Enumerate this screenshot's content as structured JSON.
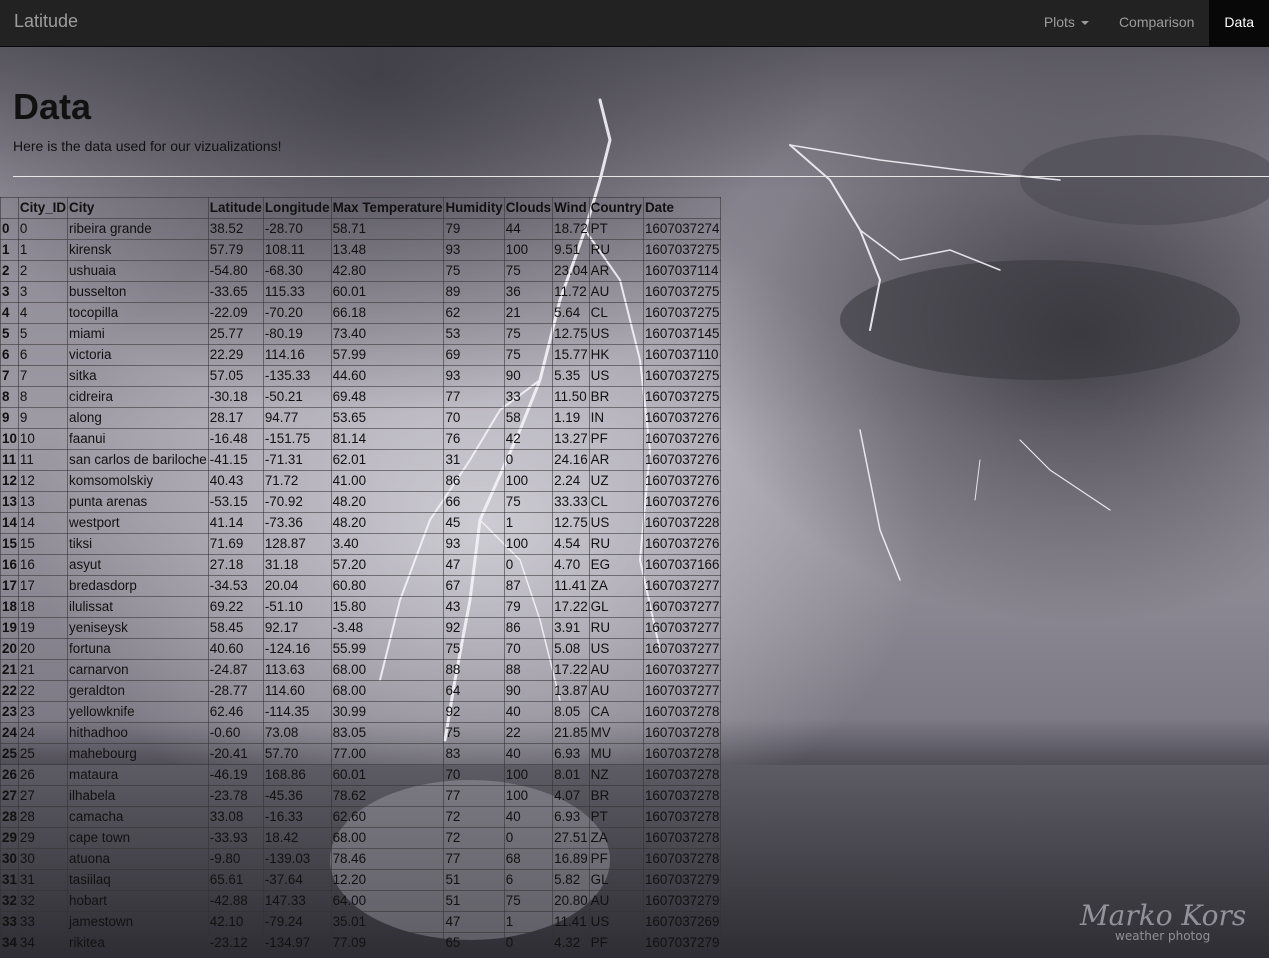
{
  "navbar": {
    "brand": "Latitude",
    "items": [
      {
        "label": "Plots",
        "dropdown": true,
        "active": false
      },
      {
        "label": "Comparison",
        "dropdown": false,
        "active": false
      },
      {
        "label": "Data",
        "dropdown": false,
        "active": true
      }
    ]
  },
  "page": {
    "title": "Data",
    "subtitle": "Here is the data used for our vizualizations!"
  },
  "background": {
    "description_icon": "lightning-storm-sea-photo",
    "watermark_line1": "Marko Kors",
    "watermark_line2": "weather photog"
  },
  "table": {
    "columns": [
      "",
      "City_ID",
      "City",
      "Latitude",
      "Longitude",
      "Max Temperature",
      "Humidity",
      "Clouds",
      "Wind",
      "Country",
      "Date"
    ],
    "rows": [
      [
        "0",
        "0",
        "ribeira grande",
        "38.52",
        "-28.70",
        "58.71",
        "79",
        "44",
        "18.72",
        "PT",
        "1607037274"
      ],
      [
        "1",
        "1",
        "kirensk",
        "57.79",
        "108.11",
        "13.48",
        "93",
        "100",
        "9.51",
        "RU",
        "1607037275"
      ],
      [
        "2",
        "2",
        "ushuaia",
        "-54.80",
        "-68.30",
        "42.80",
        "75",
        "75",
        "23.04",
        "AR",
        "1607037114"
      ],
      [
        "3",
        "3",
        "busselton",
        "-33.65",
        "115.33",
        "60.01",
        "89",
        "36",
        "11.72",
        "AU",
        "1607037275"
      ],
      [
        "4",
        "4",
        "tocopilla",
        "-22.09",
        "-70.20",
        "66.18",
        "62",
        "21",
        "5.64",
        "CL",
        "1607037275"
      ],
      [
        "5",
        "5",
        "miami",
        "25.77",
        "-80.19",
        "73.40",
        "53",
        "75",
        "12.75",
        "US",
        "1607037145"
      ],
      [
        "6",
        "6",
        "victoria",
        "22.29",
        "114.16",
        "57.99",
        "69",
        "75",
        "15.77",
        "HK",
        "1607037110"
      ],
      [
        "7",
        "7",
        "sitka",
        "57.05",
        "-135.33",
        "44.60",
        "93",
        "90",
        "5.35",
        "US",
        "1607037275"
      ],
      [
        "8",
        "8",
        "cidreira",
        "-30.18",
        "-50.21",
        "69.48",
        "77",
        "33",
        "11.50",
        "BR",
        "1607037275"
      ],
      [
        "9",
        "9",
        "along",
        "28.17",
        "94.77",
        "53.65",
        "70",
        "58",
        "1.19",
        "IN",
        "1607037276"
      ],
      [
        "10",
        "10",
        "faanui",
        "-16.48",
        "-151.75",
        "81.14",
        "76",
        "42",
        "13.27",
        "PF",
        "1607037276"
      ],
      [
        "11",
        "11",
        "san carlos de bariloche",
        "-41.15",
        "-71.31",
        "62.01",
        "31",
        "0",
        "24.16",
        "AR",
        "1607037276"
      ],
      [
        "12",
        "12",
        "komsomolskiy",
        "40.43",
        "71.72",
        "41.00",
        "86",
        "100",
        "2.24",
        "UZ",
        "1607037276"
      ],
      [
        "13",
        "13",
        "punta arenas",
        "-53.15",
        "-70.92",
        "48.20",
        "66",
        "75",
        "33.33",
        "CL",
        "1607037276"
      ],
      [
        "14",
        "14",
        "westport",
        "41.14",
        "-73.36",
        "48.20",
        "45",
        "1",
        "12.75",
        "US",
        "1607037228"
      ],
      [
        "15",
        "15",
        "tiksi",
        "71.69",
        "128.87",
        "3.40",
        "93",
        "100",
        "4.54",
        "RU",
        "1607037276"
      ],
      [
        "16",
        "16",
        "asyut",
        "27.18",
        "31.18",
        "57.20",
        "47",
        "0",
        "4.70",
        "EG",
        "1607037166"
      ],
      [
        "17",
        "17",
        "bredasdorp",
        "-34.53",
        "20.04",
        "60.80",
        "67",
        "87",
        "11.41",
        "ZA",
        "1607037277"
      ],
      [
        "18",
        "18",
        "ilulissat",
        "69.22",
        "-51.10",
        "15.80",
        "43",
        "79",
        "17.22",
        "GL",
        "1607037277"
      ],
      [
        "19",
        "19",
        "yeniseysk",
        "58.45",
        "92.17",
        "-3.48",
        "92",
        "86",
        "3.91",
        "RU",
        "1607037277"
      ],
      [
        "20",
        "20",
        "fortuna",
        "40.60",
        "-124.16",
        "55.99",
        "75",
        "70",
        "5.08",
        "US",
        "1607037277"
      ],
      [
        "21",
        "21",
        "carnarvon",
        "-24.87",
        "113.63",
        "68.00",
        "88",
        "88",
        "17.22",
        "AU",
        "1607037277"
      ],
      [
        "22",
        "22",
        "geraldton",
        "-28.77",
        "114.60",
        "68.00",
        "64",
        "90",
        "13.87",
        "AU",
        "1607037277"
      ],
      [
        "23",
        "23",
        "yellowknife",
        "62.46",
        "-114.35",
        "30.99",
        "92",
        "40",
        "8.05",
        "CA",
        "1607037278"
      ],
      [
        "24",
        "24",
        "hithadhoo",
        "-0.60",
        "73.08",
        "83.05",
        "75",
        "22",
        "21.85",
        "MV",
        "1607037278"
      ],
      [
        "25",
        "25",
        "mahebourg",
        "-20.41",
        "57.70",
        "77.00",
        "83",
        "40",
        "6.93",
        "MU",
        "1607037278"
      ],
      [
        "26",
        "26",
        "mataura",
        "-46.19",
        "168.86",
        "60.01",
        "70",
        "100",
        "8.01",
        "NZ",
        "1607037278"
      ],
      [
        "27",
        "27",
        "ilhabela",
        "-23.78",
        "-45.36",
        "78.62",
        "77",
        "100",
        "4.07",
        "BR",
        "1607037278"
      ],
      [
        "28",
        "28",
        "camacha",
        "33.08",
        "-16.33",
        "62.60",
        "72",
        "40",
        "6.93",
        "PT",
        "1607037278"
      ],
      [
        "29",
        "29",
        "cape town",
        "-33.93",
        "18.42",
        "68.00",
        "72",
        "0",
        "27.51",
        "ZA",
        "1607037278"
      ],
      [
        "30",
        "30",
        "atuona",
        "-9.80",
        "-139.03",
        "78.46",
        "77",
        "68",
        "16.89",
        "PF",
        "1607037278"
      ],
      [
        "31",
        "31",
        "tasiilaq",
        "65.61",
        "-37.64",
        "12.20",
        "51",
        "6",
        "5.82",
        "GL",
        "1607037279"
      ],
      [
        "32",
        "32",
        "hobart",
        "-42.88",
        "147.33",
        "64.00",
        "51",
        "75",
        "20.80",
        "AU",
        "1607037279"
      ],
      [
        "33",
        "33",
        "jamestown",
        "42.10",
        "-79.24",
        "35.01",
        "47",
        "1",
        "11.41",
        "US",
        "1607037269"
      ],
      [
        "34",
        "34",
        "rikitea",
        "-23.12",
        "-134.97",
        "77.09",
        "65",
        "0",
        "4.32",
        "PF",
        "1607037279"
      ]
    ]
  }
}
